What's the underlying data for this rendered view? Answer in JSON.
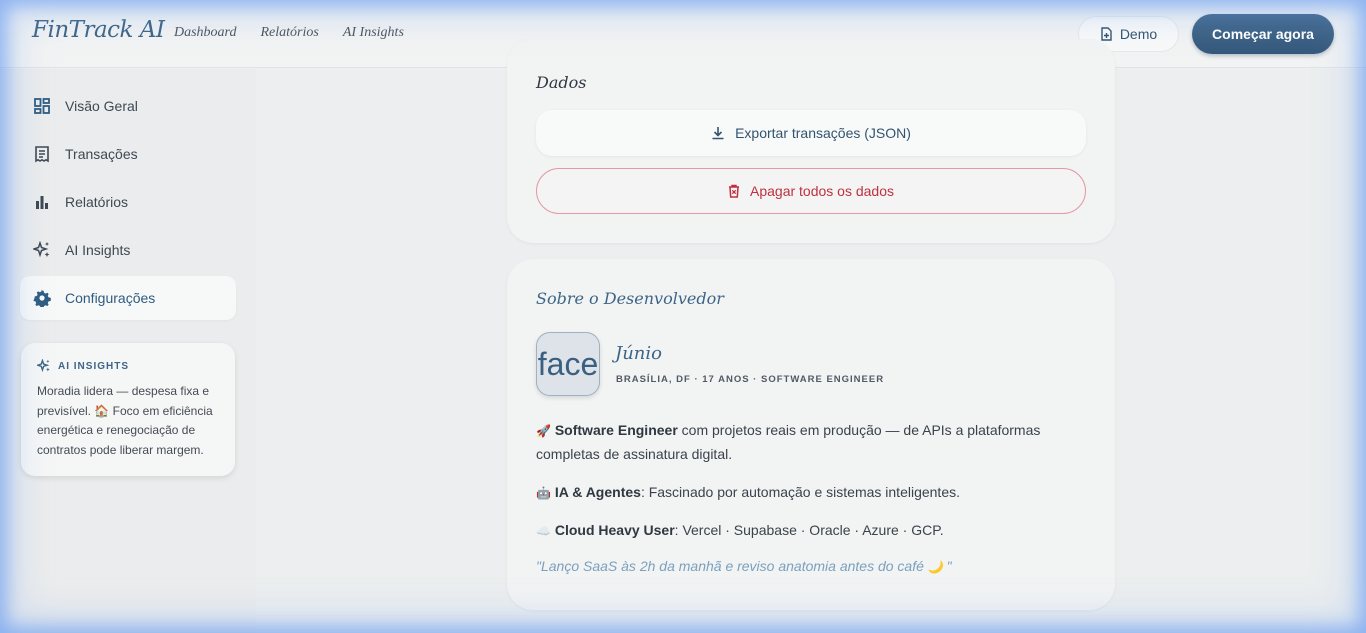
{
  "header": {
    "brand": "FinTrack AI",
    "nav": [
      "Dashboard",
      "Relatórios",
      "AI Insights"
    ],
    "demo_label": "Demo",
    "start_label": "Começar agora"
  },
  "sidebar": {
    "items": [
      {
        "label": "Visão Geral",
        "icon": "grid-icon"
      },
      {
        "label": "Transações",
        "icon": "receipt-icon"
      },
      {
        "label": "Relatórios",
        "icon": "bar-chart-icon"
      },
      {
        "label": "AI Insights",
        "icon": "sparkles-icon"
      },
      {
        "label": "Configurações",
        "icon": "gear-icon",
        "active": true
      }
    ],
    "ai_card": {
      "title": "AI INSIGHTS",
      "text_before": "Moradia lidera — despesa fixa e previsível. ",
      "emoji": "🏠",
      "text_after": " Foco em eficiência energética e renegociação de contratos pode liberar margem."
    }
  },
  "data_section": {
    "title": "Dados",
    "export_label": "Exportar transações (JSON)",
    "delete_label": "Apagar todos os dados"
  },
  "about": {
    "title": "Sobre o Desenvolvedor",
    "avatar_text": "face",
    "name": "Júnio",
    "meta": "BRASÍLIA, DF · 17 ANOS · SOFTWARE ENGINEER",
    "p1": {
      "emoji": "🚀",
      "bold": "Software Engineer",
      "text": " com projetos reais em produção — de APIs a plataformas completas de assinatura digital."
    },
    "p2": {
      "emoji": "🤖",
      "bold": "IA & Agentes",
      "text": ": Fascinado por automação e sistemas inteligentes."
    },
    "p3": {
      "emoji": "☁️",
      "bold": "Cloud Heavy User",
      "text": ": Vercel · Supabase · Oracle · Azure · GCP."
    },
    "quote_before": "\"Lanço SaaS às 2h da manhã e reviso anatomia antes do café ",
    "quote_emoji": "🌙",
    "quote_after": " \""
  },
  "colors": {
    "accent": "#3d6587",
    "danger": "#c0303e",
    "primary_button": "#3d6283"
  }
}
